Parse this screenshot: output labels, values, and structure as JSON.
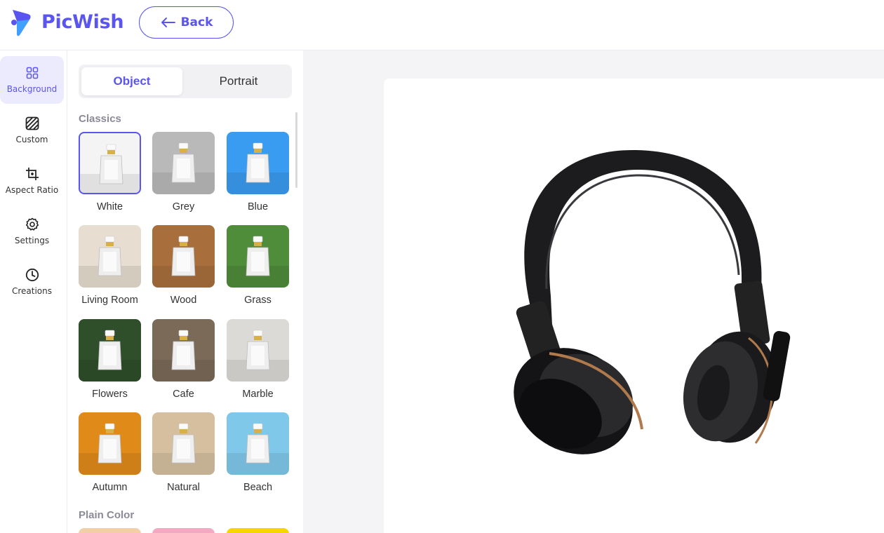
{
  "app": {
    "name": "PicWish",
    "back_label": "Back"
  },
  "sidebar": {
    "items": [
      {
        "label": "Background",
        "icon": "grid-icon",
        "active": true
      },
      {
        "label": "Custom",
        "icon": "stripes-icon",
        "active": false
      },
      {
        "label": "Aspect Ratio",
        "icon": "crop-icon",
        "active": false
      },
      {
        "label": "Settings",
        "icon": "gear-icon",
        "active": false
      },
      {
        "label": "Creations",
        "icon": "clock-icon",
        "active": false
      }
    ]
  },
  "panel": {
    "tabs": [
      {
        "label": "Object",
        "active": true
      },
      {
        "label": "Portrait",
        "active": false
      }
    ],
    "sections": [
      {
        "title": "Classics",
        "items": [
          {
            "label": "White",
            "selected": true,
            "color": "#f4f4f4"
          },
          {
            "label": "Grey",
            "selected": false,
            "color": "#b9b9b9"
          },
          {
            "label": "Blue",
            "selected": false,
            "color": "#3a9cf0"
          },
          {
            "label": "Living Room",
            "selected": false,
            "color": "#e7ddd0"
          },
          {
            "label": "Wood",
            "selected": false,
            "color": "#a86e3c"
          },
          {
            "label": "Grass",
            "selected": false,
            "color": "#4f8d3a"
          },
          {
            "label": "Flowers",
            "selected": false,
            "color": "#2f4f2a"
          },
          {
            "label": "Cafe",
            "selected": false,
            "color": "#7b6a58"
          },
          {
            "label": "Marble",
            "selected": false,
            "color": "#dcdad6"
          },
          {
            "label": "Autumn",
            "selected": false,
            "color": "#e08a1a"
          },
          {
            "label": "Natural",
            "selected": false,
            "color": "#d5bf9f"
          },
          {
            "label": "Beach",
            "selected": false,
            "color": "#7fc8ea"
          }
        ]
      },
      {
        "title": "Plain Color",
        "swatches": [
          "#f2cfa6",
          "#f4a9c3",
          "#f7d600"
        ]
      }
    ]
  },
  "accent_color": "#5a55f0"
}
